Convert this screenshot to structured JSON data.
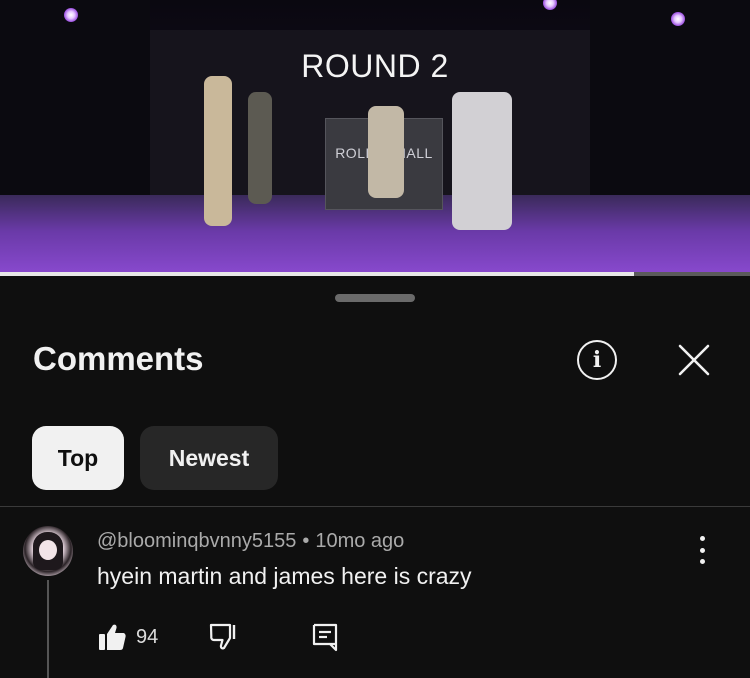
{
  "video": {
    "overlay_title": "ROUND 2",
    "podium_text": "ROLL",
    "podium_text_right": "HALL",
    "progress": 0.845
  },
  "comments_panel": {
    "title": "Comments",
    "info_icon": "info-icon",
    "close_icon": "close-icon",
    "filters": [
      {
        "label": "Top",
        "selected": true
      },
      {
        "label": "Newest",
        "selected": false
      }
    ]
  },
  "comment": {
    "author": "@bloominqbvnny5155",
    "separator": "•",
    "time": "10mo ago",
    "text": "hyein martin and james here is crazy",
    "likes": "94"
  },
  "colors": {
    "background": "#0f0f0f",
    "chip_selected": "#f1f1f1",
    "chip_unselected": "#272727",
    "stage_purple": "#8a4ad0"
  }
}
